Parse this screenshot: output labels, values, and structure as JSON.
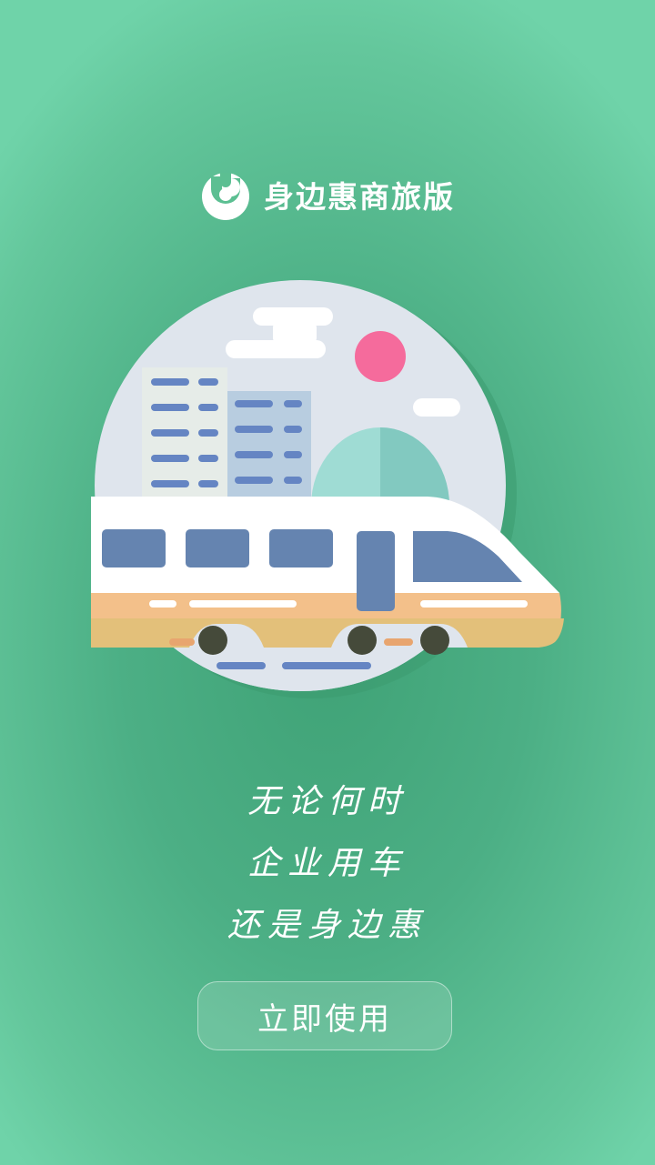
{
  "brand": {
    "app_name": "身边惠商旅版",
    "logo_icon": "app-logo-icon"
  },
  "hero": {
    "icon": "train-city-illustration-icon"
  },
  "slogan": {
    "lines": [
      "无论何时",
      "企业用车",
      "还是身边惠"
    ]
  },
  "cta": {
    "label": "立即使用"
  },
  "colors": {
    "background": "#4caf85",
    "circle_bg": "#dfe5ed",
    "train_body": "#ffffff",
    "train_window": "#6584b0",
    "train_stripe": "#f3c08a",
    "sun": "#f56b9c",
    "dome": "#9fdcd4",
    "wheel": "#454a3a"
  }
}
